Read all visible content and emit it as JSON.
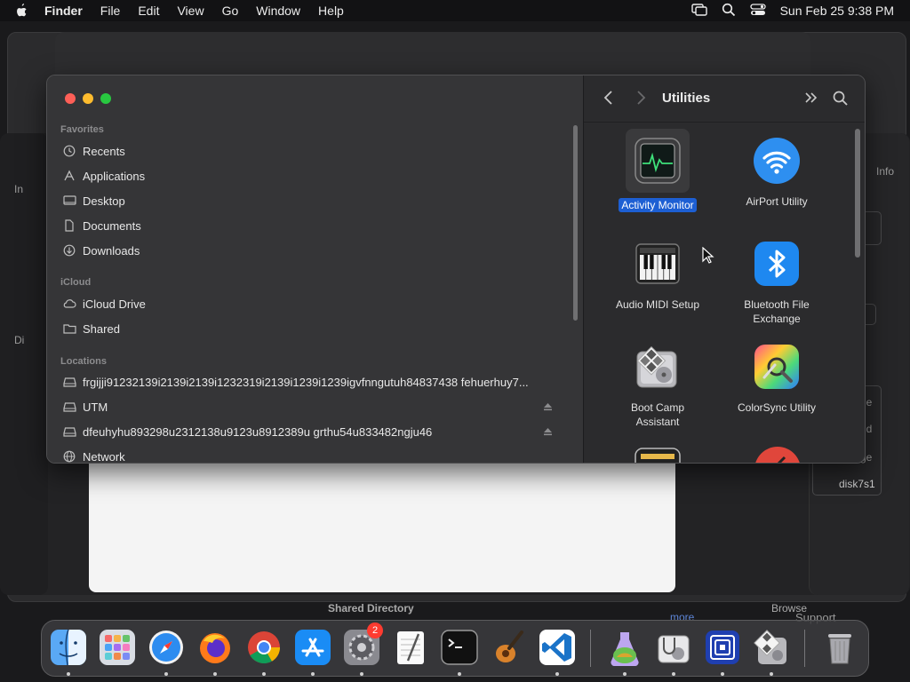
{
  "menubar": {
    "app_name": "Finder",
    "items": [
      "File",
      "Edit",
      "View",
      "Go",
      "Window",
      "Help"
    ],
    "clock": "Sun Feb 25  9:38 PM"
  },
  "background": {
    "shared_directory": "Shared Directory",
    "browse": "Browse",
    "support": "Support",
    "more": "more",
    "disk": "disk7s1",
    "info": "Info",
    "frag_in": "In",
    "frag_di": "Di",
    "frag_ne": "ne",
    "frag_nd": "nd",
    "frag_ge": "ge"
  },
  "finder": {
    "sidebar": {
      "favorites_header": "Favorites",
      "favorites": [
        "Recents",
        "Applications",
        "Desktop",
        "Documents",
        "Downloads"
      ],
      "icloud_header": "iCloud",
      "icloud": [
        "iCloud Drive",
        "Shared"
      ],
      "locations_header": "Locations",
      "locations": [
        "frgijji91232139i2139i2139i1232319i2139i1239i1239igvfnngutuh84837438 fehuerhuy7...",
        "UTM",
        "dfeuhyhu893298u2312138u9123u8912389u grthu54u833482ngju46",
        "Network"
      ]
    },
    "toolbar": {
      "title": "Utilities"
    },
    "apps": [
      {
        "label": "Activity Monitor",
        "selected": true
      },
      {
        "label": "AirPort Utility"
      },
      {
        "label": "Audio MIDI Setup"
      },
      {
        "label_line1": "Bluetooth File",
        "label_line2": "Exchange"
      },
      {
        "label_line1": "Boot Camp",
        "label_line2": "Assistant"
      },
      {
        "label": "ColorSync Utility"
      }
    ]
  },
  "dock": {
    "apps": [
      "Finder",
      "Launchpad",
      "Safari",
      "Firefox",
      "Chrome",
      "App Store",
      "System Settings",
      "TextEdit",
      "Terminal",
      "GarageBand",
      "Visual Studio Code",
      "Disk Utility",
      "Utility",
      "UTM",
      "Boot Camp Assistant",
      "Trash"
    ],
    "settings_badge": "2"
  },
  "colors": {
    "selection": "#1d5fd3",
    "close": "#fe5f57",
    "minimize": "#febc2e",
    "zoom": "#28c840"
  }
}
